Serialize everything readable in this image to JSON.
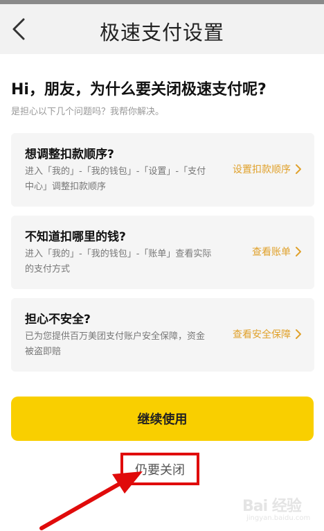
{
  "nav": {
    "title": "极速支付设置",
    "back_icon": "chevron-left-icon"
  },
  "intro": {
    "headline": "Hi，朋友，为什么要关闭极速支付呢?",
    "subline": "是担心以下几个问题吗？我帮你解决。"
  },
  "cards": [
    {
      "title": "想调整扣款顺序?",
      "desc": "进入「我的」-「我的钱包」-「设置」-「支付中心」调整扣款顺序",
      "link": "设置扣款顺序"
    },
    {
      "title": "不知道扣哪里的钱?",
      "desc": "进入「我的」-「我的钱包」-「账单」查看实际的支付方式",
      "link": "查看账单"
    },
    {
      "title": "担心不安全?",
      "desc": "已为您提供百万美团支付账户安全保障，资金被盗即赔",
      "link": "查看安全保障"
    }
  ],
  "actions": {
    "continue_label": "继续使用",
    "close_label": "仍要关闭"
  },
  "colors": {
    "accent_yellow": "#f9cf00",
    "link_orange": "#e0a12b",
    "annotation_red": "#e00b0b"
  },
  "watermark": {
    "logo": "Bai 经验",
    "url": "jingyan.baidu.com"
  }
}
